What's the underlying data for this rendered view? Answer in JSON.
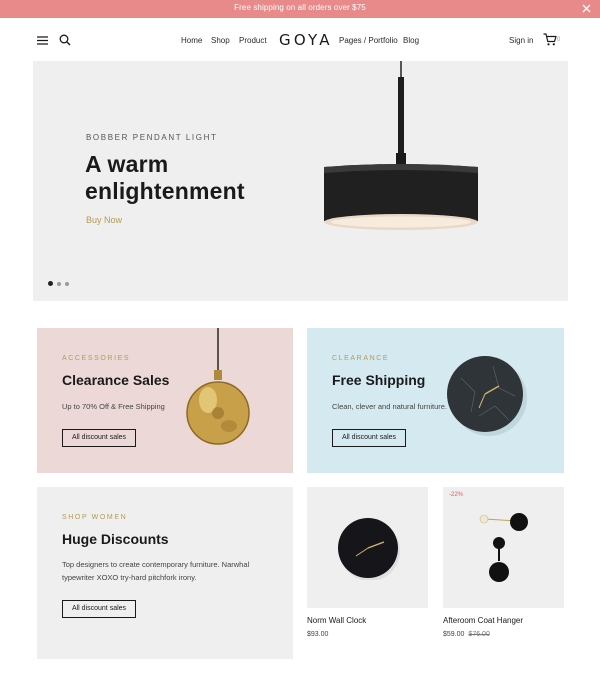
{
  "announcement": {
    "text": "Free shipping on all orders over $75",
    "close_icon": "close-icon"
  },
  "header": {
    "menu_icon": "hamburger-menu-icon",
    "search_icon": "search-icon",
    "nav": [
      "Home",
      "Shop",
      "Product",
      "Pages / Portfolio",
      "Blog"
    ],
    "logo": "GOYA",
    "signin": "Sign in",
    "cart_icon": "cart-icon",
    "cart_count": "0"
  },
  "hero": {
    "eyebrow": "BOBBER PENDANT LIGHT",
    "title_line1": "A warm",
    "title_line2": "enlightenment",
    "cta": "Buy Now",
    "slides": 3,
    "active_slide": 1
  },
  "promos": [
    {
      "eyebrow": "ACCESSORIES",
      "title": "Clearance Sales",
      "desc": "Up to 70% Off & Free Shipping",
      "button": "All discount sales"
    },
    {
      "eyebrow": "CLEARANCE",
      "title": "Free Shipping",
      "desc": "Clean, clever and natural furniture.",
      "button": "All discount sales"
    },
    {
      "eyebrow": "SHOP WOMEN",
      "title": "Huge Discounts",
      "desc_line1": "Top designers to create contemporary furniture. Narwhal",
      "desc_line2": "typewriter XOXO try-hard pitchfork irony.",
      "button": "All discount sales"
    }
  ],
  "products": [
    {
      "name": "Norm Wall Clock",
      "price": "$93.00"
    },
    {
      "name": "Afteroom Coat Hanger",
      "price": "$59.00",
      "old_price": "$76.00",
      "badge": "-22%"
    }
  ],
  "colors": {
    "announcement_bg": "#e98a8a",
    "accent_gold": "#b39a55",
    "card_pink": "#ecd9d7",
    "card_blue": "#d5eaf0",
    "card_grey": "#efefef",
    "sale_red": "#e35a5a"
  }
}
